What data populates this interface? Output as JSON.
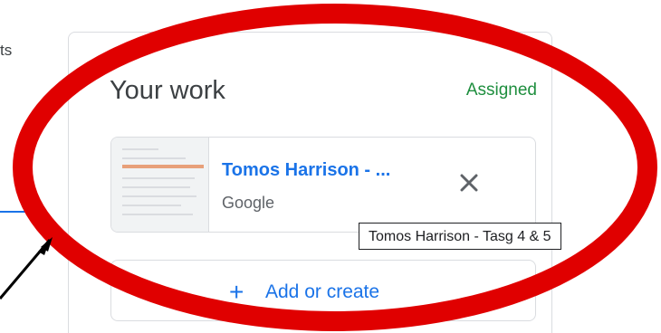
{
  "page": {
    "left_fragment": "ts"
  },
  "card": {
    "title": "Your work",
    "status": "Assigned"
  },
  "attachment": {
    "title": "Tomos Harrison - ...",
    "type_label": "Google",
    "tooltip": "Tomos Harrison - Tasg 4 & 5"
  },
  "add_button": {
    "icon": "plus-icon",
    "label": "Add or create"
  },
  "colors": {
    "annotation_red": "#e00000",
    "accent_blue": "#1a73e8",
    "assigned_green": "#1e8e3e"
  }
}
